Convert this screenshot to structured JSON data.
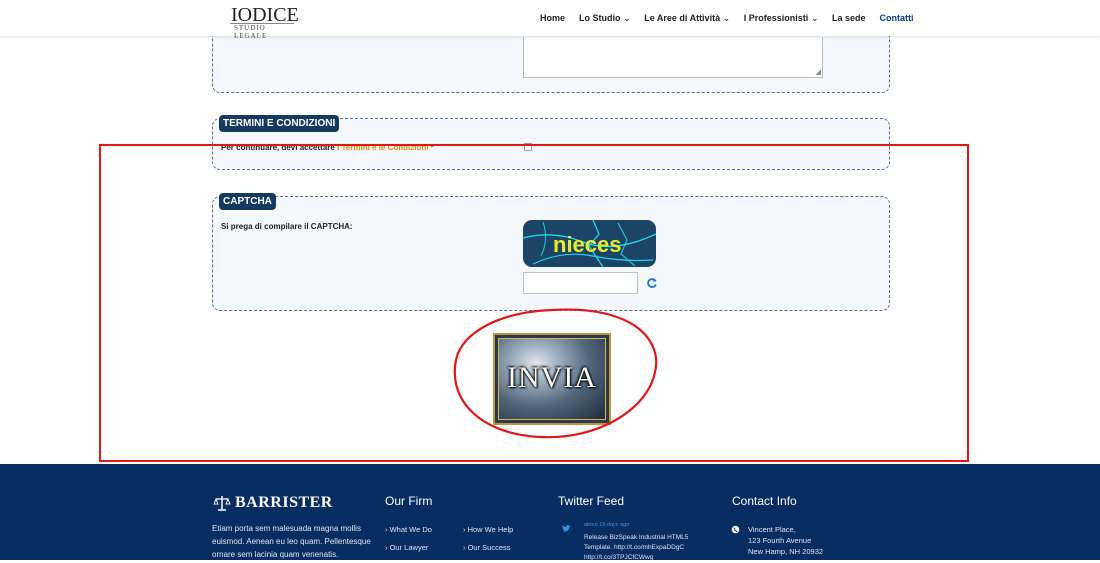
{
  "header": {
    "logo_main": "IODICE",
    "logo_sub": "STUDIO LEGALE",
    "nav": [
      {
        "label": "Home",
        "dropdown": false,
        "active": false
      },
      {
        "label": "Lo Studio",
        "dropdown": true,
        "active": false
      },
      {
        "label": "Le Aree di Attività",
        "dropdown": true,
        "active": false
      },
      {
        "label": "I Professionisti",
        "dropdown": true,
        "active": false
      },
      {
        "label": "La sede",
        "dropdown": false,
        "active": false
      },
      {
        "label": "Contatti",
        "dropdown": false,
        "active": true
      }
    ]
  },
  "terms": {
    "legend": "TERMINI E CONDIZIONI",
    "text": "Per continuare, devi accettare ",
    "link": "I Termini e le Condizioni",
    "required_mark": "*"
  },
  "captcha": {
    "legend": "CAPTCHA",
    "label": "Si prega di compilare il CAPTCHA:",
    "image_text": "nieces",
    "input_value": ""
  },
  "submit": {
    "label": "INVIA"
  },
  "footer": {
    "brand": "BARRISTER",
    "about": "Etiam porta sem malesuada magna mollis euismod. Aenean eu leo quam. Pellentesque ornare sem lacinia quam venenatis.",
    "firm_heading": "Our Firm",
    "firm_links": [
      "What We Do",
      "Our Lawyer",
      "How We Help",
      "Our Success"
    ],
    "twitter_heading": "Twitter Feed",
    "tweet_time": "about 19 days ago",
    "tweet_text": "Release BizSpeak Industrial HTML5 Template. http://t.co/mhExpaDDgC http://t.co/3TPJCfCWwg",
    "contact_heading": "Contact Info",
    "address": [
      "Vincent Place,",
      "123 Fourth Avenue",
      "New Hamp, NH 20932"
    ]
  },
  "colors": {
    "navy": "#163a5f",
    "footer_bg": "#072d62",
    "link_orange": "#e08a00",
    "annotation_red": "#e01818"
  }
}
